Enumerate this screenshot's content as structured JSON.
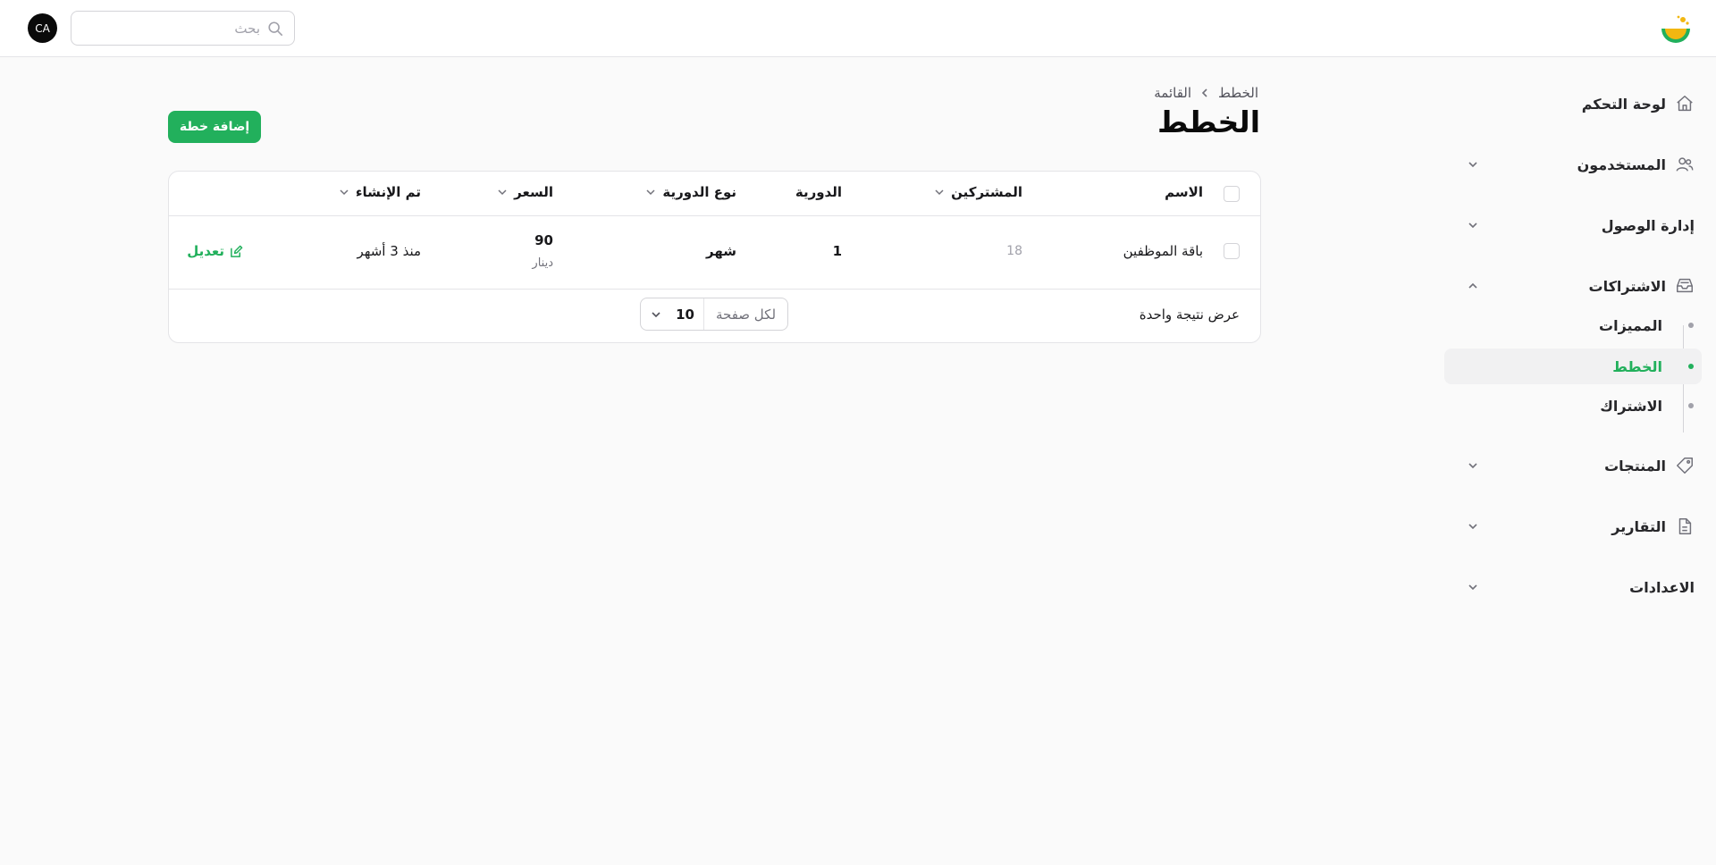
{
  "header": {
    "search_placeholder": "بحث",
    "avatar_initials": "CA"
  },
  "sidebar": {
    "dashboard": "لوحة التحكم",
    "users": "المستخدمون",
    "access": "إدارة الوصول",
    "subscriptions": "الاشتراكات",
    "sub_items": [
      "المميزات",
      "الخطط",
      "الاشتراك"
    ],
    "products": "المنتجات",
    "reports": "التقارير",
    "settings": "الاعدادات"
  },
  "breadcrumb": {
    "parent": "الخطط",
    "current": "القائمة"
  },
  "page": {
    "title": "الخطط",
    "add_button": "إضافة خطة"
  },
  "table": {
    "columns": {
      "name": "الاسم",
      "subscribers": "المشتركين",
      "period": "الدورية",
      "period_type": "نوع الدورية",
      "price": "السعر",
      "created": "تم الإنشاء"
    },
    "rows": [
      {
        "name": "باقة الموظفين",
        "subscribers": "18",
        "period": "1",
        "period_type": "شهر",
        "price": "90",
        "currency": "دينار",
        "created": "منذ 3 أشهر",
        "action": "تعديل"
      }
    ],
    "footer": {
      "results": "عرض نتيجة واحدة",
      "per_page_label": "لكل صفحة",
      "per_page_value": "10"
    }
  },
  "colors": {
    "accent": "#22b05c",
    "background": "#fafafa"
  }
}
